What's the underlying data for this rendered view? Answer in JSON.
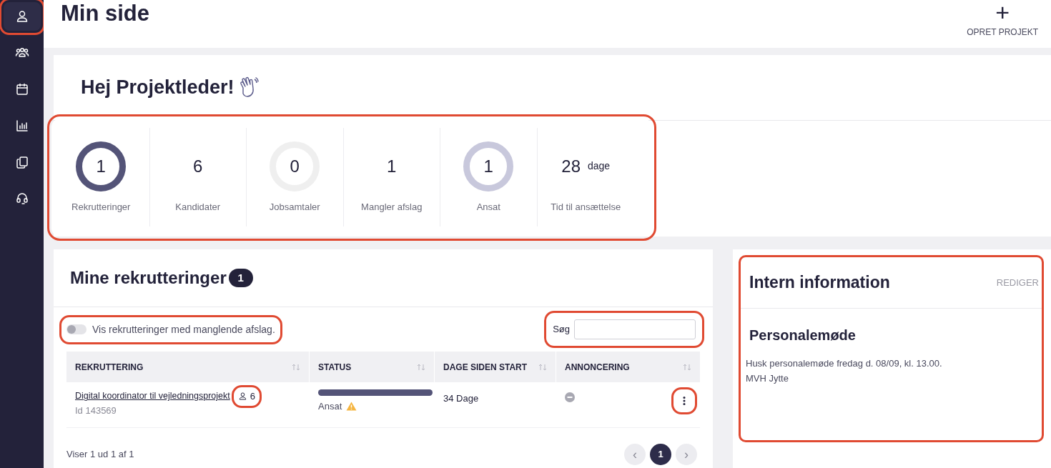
{
  "sidebar": {
    "items": [
      {
        "selected": true,
        "highlighted": true
      },
      {
        "selected": false,
        "highlighted": false
      },
      {
        "selected": false,
        "highlighted": false
      },
      {
        "selected": false,
        "highlighted": false
      },
      {
        "selected": false,
        "highlighted": false
      },
      {
        "selected": false,
        "highlighted": false
      }
    ]
  },
  "header": {
    "title": "Min side",
    "action": {
      "icon": "+",
      "label": "OPRET PROJEKT"
    }
  },
  "greeting": {
    "title": "Hej Projektleder!"
  },
  "stats": {
    "highlighted": true,
    "items": [
      {
        "kind": "ring",
        "value": "1",
        "label": "Rekrutteringer",
        "color": "#545478"
      },
      {
        "kind": "number",
        "value": "6",
        "label": "Kandidater"
      },
      {
        "kind": "ring",
        "value": "0",
        "label": "Jobsamtaler",
        "color": "#efefef"
      },
      {
        "kind": "number",
        "value": "1",
        "label": "Mangler afslag"
      },
      {
        "kind": "ring",
        "value": "1",
        "label": "Ansat",
        "color": "#c8c8dc"
      },
      {
        "kind": "days",
        "value": "28",
        "unit": "dage",
        "label": "Tid til ansættelse"
      }
    ]
  },
  "recruitments": {
    "title": "Mine rekrutteringer",
    "count": "1",
    "toggle": {
      "label": "Vis rekrutteringer med manglende afslag.",
      "on": false,
      "highlighted": true
    },
    "search": {
      "label": "Søg",
      "highlighted": true
    },
    "table": {
      "columns": [
        "REKRUTTERING",
        "STATUS",
        "DAGE SIDEN START",
        "ANNONCERING"
      ],
      "rows": [
        {
          "title": "Digital koordinator til vejledningsprojekt",
          "id": "Id 143569",
          "candidates": "6",
          "level": 1,
          "status": "Ansat",
          "warning": true,
          "days": "34 Dage",
          "ad_active": false,
          "highlighted": true
        }
      ]
    },
    "footer": "Viser 1 ud 1 af 1",
    "pagination": {
      "prev": "‹",
      "pages": [
        {
          "label": "1",
          "selected": true
        }
      ],
      "next": "›"
    }
  },
  "info": {
    "title": "Intern information",
    "edit": "REDIGER",
    "heading": "Personalemøde",
    "lines": [
      "Husk personalemøde fredag d. 08/09, kl. 13.00.",
      "MVH Jytte"
    ],
    "highlighted": true
  }
}
